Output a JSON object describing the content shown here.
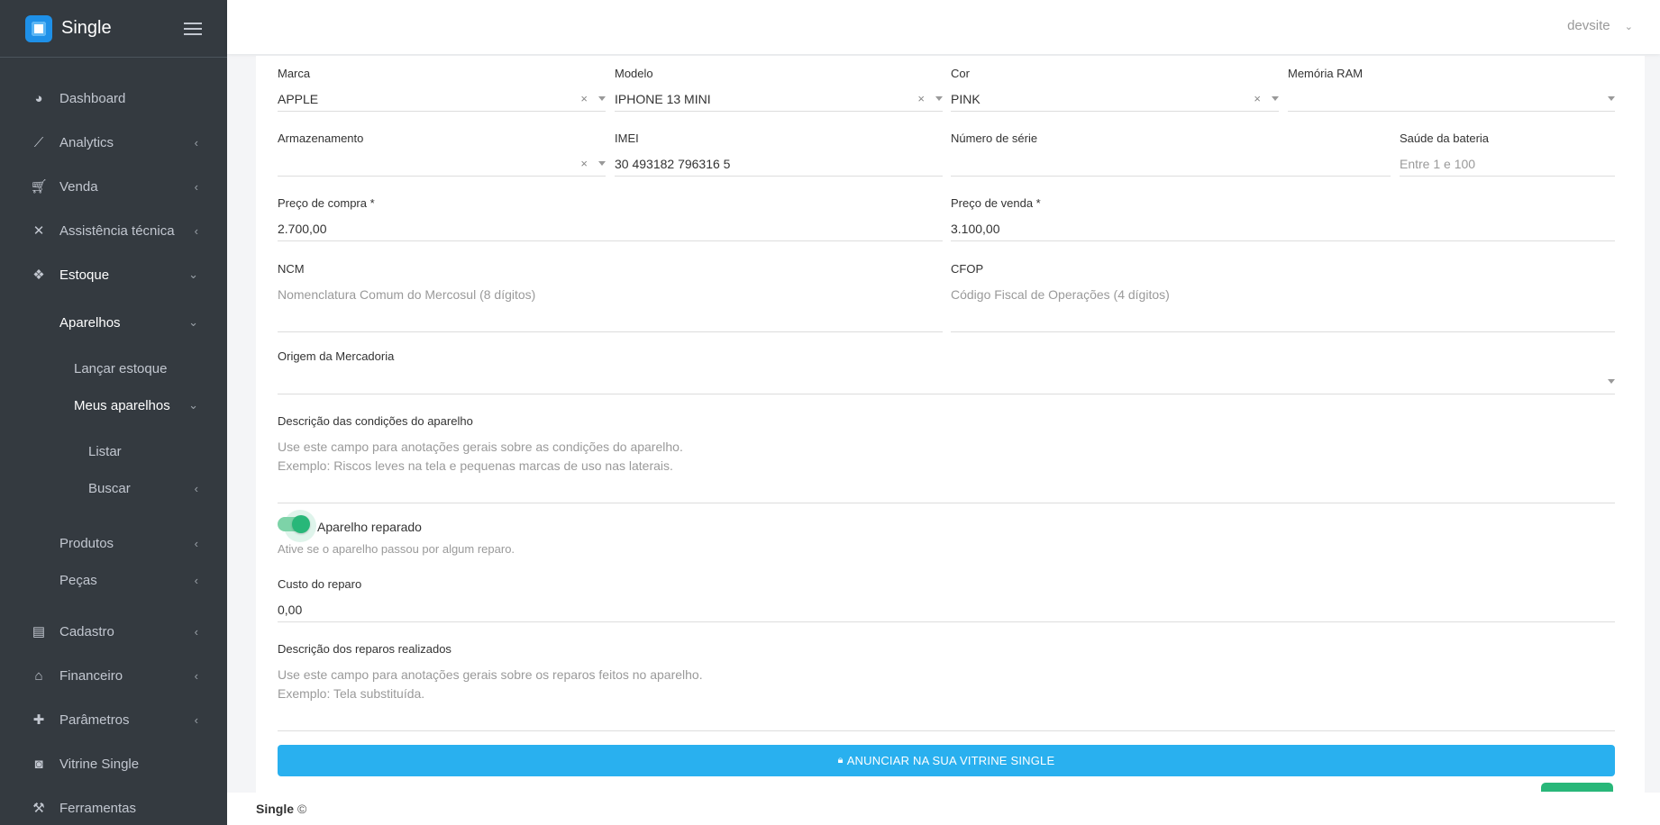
{
  "app": {
    "name": "Single"
  },
  "topbar": {
    "user": "devsite"
  },
  "sidebar": {
    "items": [
      {
        "label": "Dashboard",
        "icon": "dashboard-icon"
      },
      {
        "label": "Analytics",
        "icon": "chart-line-icon"
      },
      {
        "label": "Venda",
        "icon": "cart-icon"
      },
      {
        "label": "Assistência técnica",
        "icon": "tools-icon"
      },
      {
        "label": "Estoque",
        "icon": "cubes-icon"
      },
      {
        "label": "Aparelhos"
      },
      {
        "label": "Lançar estoque"
      },
      {
        "label": "Meus aparelhos"
      },
      {
        "label": "Listar"
      },
      {
        "label": "Buscar"
      },
      {
        "label": "Produtos"
      },
      {
        "label": "Peças"
      },
      {
        "label": "Cadastro",
        "icon": "id-card-icon"
      },
      {
        "label": "Financeiro",
        "icon": "bank-icon"
      },
      {
        "label": "Parâmetros",
        "icon": "puzzle-icon"
      },
      {
        "label": "Vitrine Single",
        "icon": "bag-icon"
      },
      {
        "label": "Ferramentas",
        "icon": "wrench-icon"
      }
    ]
  },
  "form": {
    "marca": {
      "label": "Marca",
      "value": "APPLE"
    },
    "modelo": {
      "label": "Modelo",
      "value": "IPHONE 13 MINI"
    },
    "cor": {
      "label": "Cor",
      "value": "PINK"
    },
    "memoria": {
      "label": "Memória RAM",
      "value": ""
    },
    "armazenamento": {
      "label": "Armazenamento",
      "value": ""
    },
    "imei": {
      "label": "IMEI",
      "value": "30 493182 796316 5"
    },
    "serie": {
      "label": "Número de série",
      "value": ""
    },
    "bateria": {
      "label": "Saúde da bateria",
      "placeholder": "Entre 1 e 100"
    },
    "preco_compra": {
      "label": "Preço de compra *",
      "value": "2.700,00"
    },
    "preco_venda": {
      "label": "Preço de venda *",
      "value": "3.100,00"
    },
    "ncm": {
      "label": "NCM",
      "placeholder": "Nomenclatura Comum do Mercosul (8 dígitos)"
    },
    "cfop": {
      "label": "CFOP",
      "placeholder": "Código Fiscal de Operações (4 dígitos)"
    },
    "origem": {
      "label": "Origem da Mercadoria",
      "value": ""
    },
    "descricao": {
      "label": "Descrição das condições do aparelho",
      "placeholder_line1": "Use este campo para anotações gerais sobre as condições do aparelho.",
      "placeholder_line2": "Exemplo: Riscos leves na tela e pequenas marcas de uso nas laterais."
    },
    "reparado": {
      "label": "Aparelho reparado",
      "help": "Ative se o aparelho passou por algum reparo.",
      "checked": true
    },
    "custo_reparo": {
      "label": "Custo do reparo",
      "value": "0,00"
    },
    "reparos": {
      "label": "Descrição dos reparos realizados",
      "placeholder_line1": "Use este campo para anotações gerais sobre os reparos feitos no aparelho.",
      "placeholder_line2": "Exemplo: Tela substituída."
    },
    "cta_label": "ANUNCIAR NA SUA VITRINE SINGLE"
  },
  "footer": {
    "brand": "Single",
    "copyright": "©"
  },
  "colors": {
    "sidebar": "#343a40",
    "accent": "#29b0ef",
    "toggle": "#28b779"
  }
}
